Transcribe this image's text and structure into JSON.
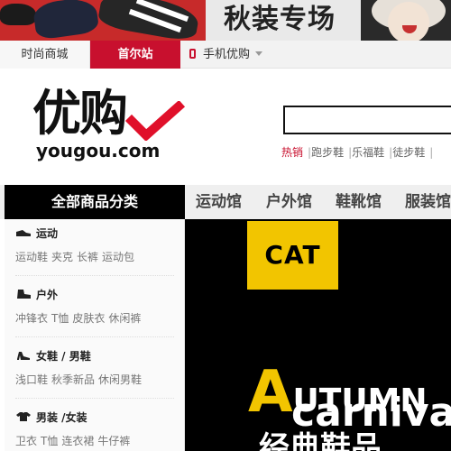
{
  "promo": {
    "title": "秋装专场"
  },
  "util_nav": {
    "items": [
      "时尚商城",
      "首尔站"
    ],
    "mobile": "手机优购"
  },
  "header": {
    "logo_cn": "优购",
    "logo_en": "yougou.com",
    "hot_links": [
      "热销",
      "跑步鞋",
      "乐福鞋",
      "徒步鞋"
    ]
  },
  "main_nav": {
    "all_categories": "全部商品分类",
    "items": [
      "运动馆",
      "户外馆",
      "鞋靴馆",
      "服装馆"
    ]
  },
  "sidebar": {
    "categories": [
      {
        "name": "运动",
        "icon": "sneaker-icon",
        "links": [
          "运动鞋",
          "夹克",
          "长裤",
          "运动包"
        ]
      },
      {
        "name": "户外",
        "icon": "boot-icon",
        "links": [
          "冲锋衣",
          "T恤",
          "皮肤衣",
          "休闲裤"
        ]
      },
      {
        "name": "女鞋 / 男鞋",
        "icon": "heel-icon",
        "links": [
          "浅口鞋",
          "秋季新品",
          "休闲男鞋"
        ]
      },
      {
        "name": "男装 /女装",
        "icon": "shirt-icon",
        "links": [
          "卫衣",
          "T恤",
          "连衣裙",
          "牛仔裤"
        ]
      }
    ]
  },
  "hero": {
    "brand": "CAT",
    "line1_initial": "A",
    "line1_rest": "UTUMN",
    "line2": "carniva",
    "line3": "经典鞋品"
  },
  "colors": {
    "brand_red": "#c8102e",
    "cat_yellow": "#f2c500"
  }
}
